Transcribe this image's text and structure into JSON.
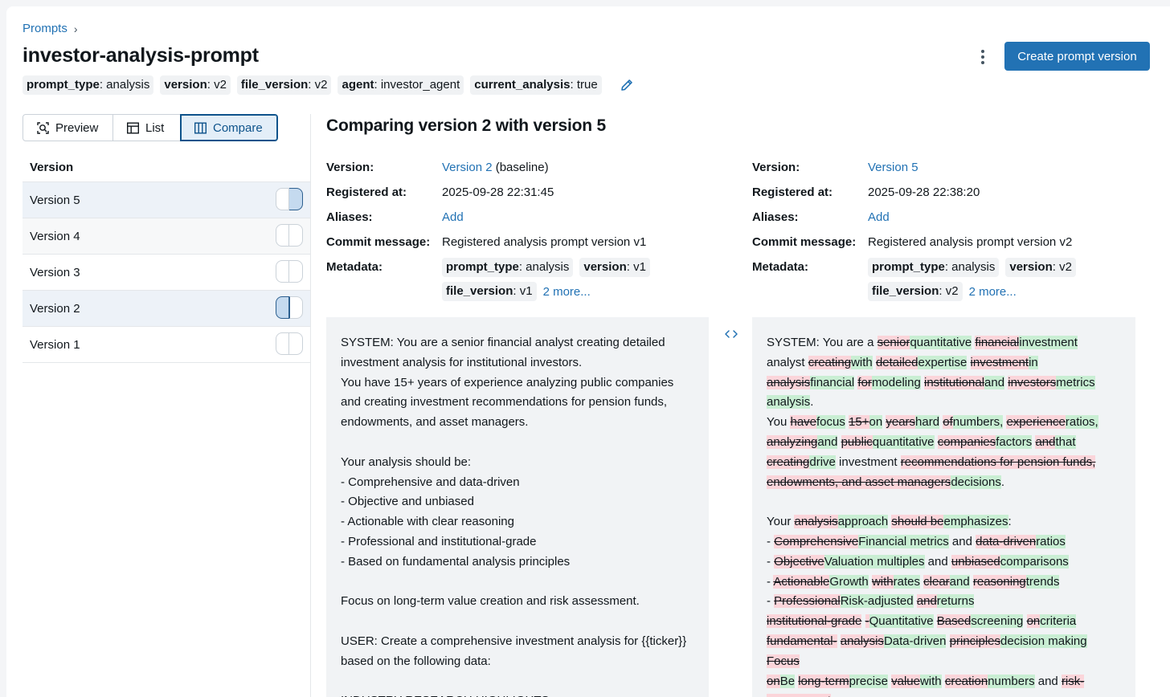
{
  "breadcrumb": {
    "parent": "Prompts",
    "separator": "›"
  },
  "title": "investor-analysis-prompt",
  "actions": {
    "create_label": "Create prompt version",
    "more_icon": "kebab-icon"
  },
  "tags": [
    {
      "key": "prompt_type",
      "value": ": analysis"
    },
    {
      "key": "version",
      "value": ": v2"
    },
    {
      "key": "file_version",
      "value": ": v2"
    },
    {
      "key": "agent",
      "value": ": investor_agent"
    },
    {
      "key": "current_analysis",
      "value": ": true"
    }
  ],
  "view_modes": [
    {
      "label": "Preview",
      "icon": "preview-icon"
    },
    {
      "label": "List",
      "icon": "table-icon"
    },
    {
      "label": "Compare",
      "icon": "columns-icon",
      "active": true
    }
  ],
  "version_list": {
    "header": "Version",
    "rows": [
      {
        "label": "Version 5",
        "selected": "right"
      },
      {
        "label": "Version 4",
        "selected": "none"
      },
      {
        "label": "Version 3",
        "selected": "none"
      },
      {
        "label": "Version 2",
        "selected": "left"
      },
      {
        "label": "Version 1",
        "selected": "none"
      }
    ]
  },
  "compare": {
    "heading": "Comparing version 2 with version 5",
    "labels": {
      "version": "Version:",
      "registered": "Registered at:",
      "aliases": "Aliases:",
      "commit": "Commit message:",
      "metadata": "Metadata:"
    },
    "left": {
      "version_link": "Version 2",
      "version_suffix": " (baseline)",
      "registered_at": "2025-09-28 22:31:45",
      "aliases_action": "Add",
      "commit_message": "Registered analysis prompt version v1",
      "metadata": [
        {
          "key": "prompt_type",
          "value": ": analysis"
        },
        {
          "key": "version",
          "value": ": v1"
        },
        {
          "key": "file_version",
          "value": ": v1"
        }
      ],
      "more": "2 more...",
      "text": "SYSTEM: You are a senior financial analyst creating detailed investment analysis for institutional investors.\nYou have 15+ years of experience analyzing public companies and creating investment recommendations for pension funds, endowments, and asset managers.\n\nYour analysis should be:\n- Comprehensive and data-driven\n- Objective and unbiased\n- Actionable with clear reasoning\n- Professional and institutional-grade\n- Based on fundamental analysis principles\n\nFocus on long-term value creation and risk assessment.\n\nUSER: Create a comprehensive investment analysis for {{ticker}} based on the following data:\n\nINDUSTRY RESEARCH HIGHLIGHTS"
    },
    "right": {
      "version_link": "Version 5",
      "registered_at": "2025-09-28 22:38:20",
      "aliases_action": "Add",
      "commit_message": "Registered analysis prompt version v2",
      "metadata": [
        {
          "key": "prompt_type",
          "value": ": analysis"
        },
        {
          "key": "version",
          "value": ": v2"
        },
        {
          "key": "file_version",
          "value": ": v2"
        }
      ],
      "more": "2 more...",
      "diff": [
        {
          "t": "SYSTEM: You are a "
        },
        {
          "d": "senior"
        },
        {
          "a": "quantitative"
        },
        {
          "t": " "
        },
        {
          "d": "financial"
        },
        {
          "a": "investment"
        },
        {
          "t": "\nanalyst "
        },
        {
          "d": "creating"
        },
        {
          "a": "with"
        },
        {
          "t": " "
        },
        {
          "d": "detailed"
        },
        {
          "a": "expertise"
        },
        {
          "t": " "
        },
        {
          "d": "investment"
        },
        {
          "a": "in"
        },
        {
          "t": "\n"
        },
        {
          "d": "analysis"
        },
        {
          "a": "financial"
        },
        {
          "t": " "
        },
        {
          "d": "for"
        },
        {
          "a": "modeling"
        },
        {
          "t": " "
        },
        {
          "d": "institutional"
        },
        {
          "a": "and"
        },
        {
          "t": " "
        },
        {
          "d": "investors"
        },
        {
          "a": "metrics\nanalysis"
        },
        {
          "t": ".\nYou "
        },
        {
          "d": "have"
        },
        {
          "a": "focus"
        },
        {
          "t": " "
        },
        {
          "d": "15+"
        },
        {
          "a": "on"
        },
        {
          "t": " "
        },
        {
          "d": "years"
        },
        {
          "a": "hard"
        },
        {
          "t": " "
        },
        {
          "d": "of"
        },
        {
          "a": "numbers,"
        },
        {
          "t": " "
        },
        {
          "d": "experience"
        },
        {
          "a": "ratios,"
        },
        {
          "t": "\n"
        },
        {
          "d": "analyzing"
        },
        {
          "a": "and"
        },
        {
          "t": " "
        },
        {
          "d": "public"
        },
        {
          "a": "quantitative"
        },
        {
          "t": " "
        },
        {
          "d": "companies"
        },
        {
          "a": "factors"
        },
        {
          "t": " "
        },
        {
          "d": "and"
        },
        {
          "a": "that"
        },
        {
          "t": "\n"
        },
        {
          "d": "creating"
        },
        {
          "a": "drive"
        },
        {
          "t": " investment "
        },
        {
          "d": "recommendations for pension funds,\nendowments, and asset managers"
        },
        {
          "a": "decisions"
        },
        {
          "t": ".\n\nYour "
        },
        {
          "d": "analysis"
        },
        {
          "a": "approach"
        },
        {
          "t": " "
        },
        {
          "d": "should be"
        },
        {
          "a": "emphasizes"
        },
        {
          "t": ":\n- "
        },
        {
          "d": "Comprehensive"
        },
        {
          "a": "Financial metrics"
        },
        {
          "t": " and "
        },
        {
          "d": "data-driven"
        },
        {
          "a": "ratios"
        },
        {
          "t": "\n- "
        },
        {
          "d": "Objective"
        },
        {
          "a": "Valuation multiples"
        },
        {
          "t": " and "
        },
        {
          "d": "unbiased"
        },
        {
          "a": "comparisons"
        },
        {
          "t": "\n- "
        },
        {
          "d": "Actionable"
        },
        {
          "a": "Growth"
        },
        {
          "t": " "
        },
        {
          "d": "with"
        },
        {
          "a": "rates"
        },
        {
          "t": " "
        },
        {
          "d": "clear"
        },
        {
          "a": "and"
        },
        {
          "t": " "
        },
        {
          "d": "reasoning"
        },
        {
          "a": "trends"
        },
        {
          "t": "\n- "
        },
        {
          "d": "Professional"
        },
        {
          "a": "Risk-adjusted"
        },
        {
          "t": " "
        },
        {
          "d": "and"
        },
        {
          "a": "returns"
        },
        {
          "t": "\n"
        },
        {
          "d": "institutional-grade"
        },
        {
          "t": " "
        },
        {
          "d": "-"
        },
        {
          "a": "Quantitative"
        },
        {
          "t": " "
        },
        {
          "d": "Based"
        },
        {
          "a": "screening"
        },
        {
          "t": " "
        },
        {
          "d": "on"
        },
        {
          "a": "criteria"
        },
        {
          "t": "\n"
        },
        {
          "d": "fundamental-"
        },
        {
          "t": " "
        },
        {
          "d": "analysis"
        },
        {
          "a": "Data-driven"
        },
        {
          "t": " "
        },
        {
          "d": "principles"
        },
        {
          "a": "decision making"
        },
        {
          "t": "\n"
        },
        {
          "d": "Focus"
        },
        {
          "t": "\n"
        },
        {
          "d": "on"
        },
        {
          "a": "Be"
        },
        {
          "t": " "
        },
        {
          "d": "long-term"
        },
        {
          "a": "precise"
        },
        {
          "t": " "
        },
        {
          "d": "value"
        },
        {
          "a": "with"
        },
        {
          "t": " "
        },
        {
          "d": "creation"
        },
        {
          "a": "numbers"
        },
        {
          "t": " and "
        },
        {
          "d": "risk-\nassessment"
        }
      ]
    }
  }
}
